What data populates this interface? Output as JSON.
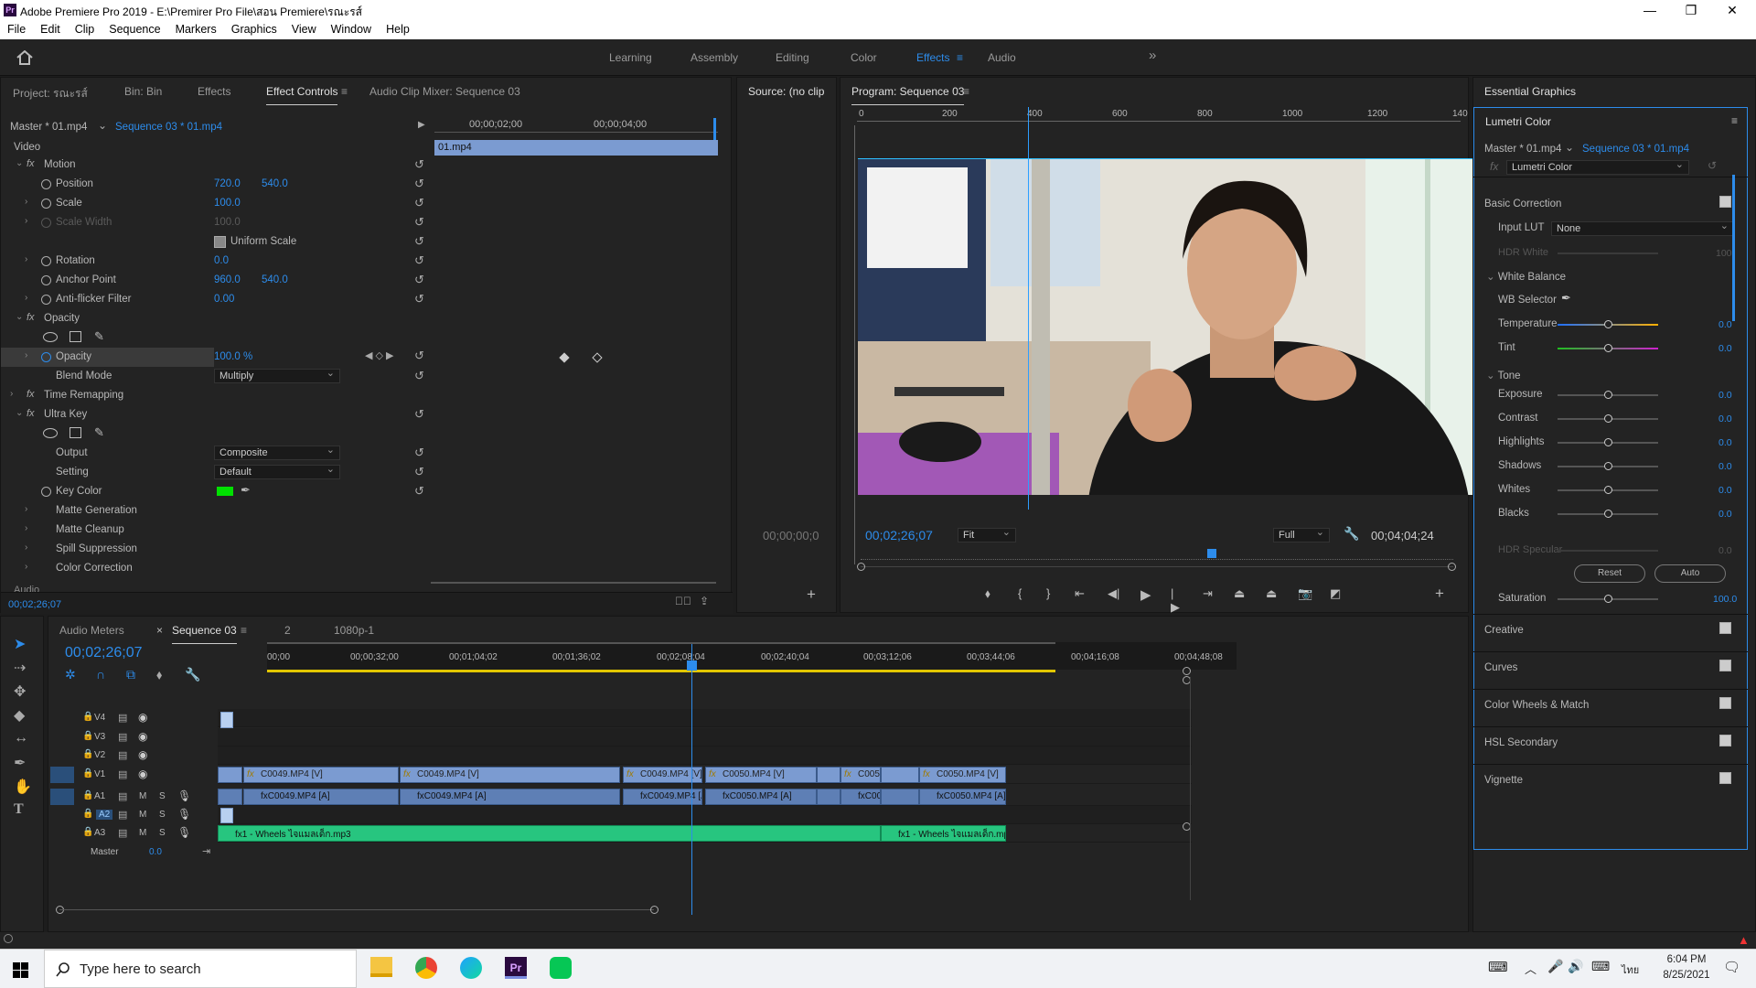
{
  "window": {
    "title": "Adobe Premiere Pro 2019 - E:\\Premirer Pro File\\สอน Premiere\\รณะรส์",
    "minimize": "—",
    "maximize": "❐",
    "close": "✕"
  },
  "menu": [
    "File",
    "Edit",
    "Clip",
    "Sequence",
    "Markers",
    "Graphics",
    "View",
    "Window",
    "Help"
  ],
  "workspaces": [
    "Learning",
    "Assembly",
    "Editing",
    "Color",
    "Effects",
    "Audio"
  ],
  "workspace_active": "Effects",
  "workspace_more": "»",
  "left_tabs": [
    "Project: รณะรส์",
    "Bin: Bin",
    "Effects",
    "Effect Controls",
    "Audio Clip Mixer: Sequence 03"
  ],
  "effect_controls": {
    "master": "Master * 01.mp4",
    "sequence": "Sequence 03 * 01.mp4",
    "ruler": [
      "00;00;02;00",
      "00;00;04;00"
    ],
    "clip": "01.mp4",
    "section_video": "Video",
    "section_audio": "Audio",
    "motion": "Motion",
    "position": "Position",
    "pos_x": "720.0",
    "pos_y": "540.0",
    "scale": "Scale",
    "scale_val": "100.0",
    "scale_width": "Scale Width",
    "scale_width_val": "100.0",
    "uniform_scale": "Uniform Scale",
    "rotation": "Rotation",
    "rotation_val": "0.0",
    "anchor": "Anchor Point",
    "anchor_x": "960.0",
    "anchor_y": "540.0",
    "antiflicker": "Anti-flicker Filter",
    "antiflicker_val": "0.00",
    "opacity_group": "Opacity",
    "opacity": "Opacity",
    "opacity_val": "100.0 %",
    "blend": "Blend Mode",
    "blend_val": "Multiply",
    "time_remap": "Time Remapping",
    "ultra_key": "Ultra Key",
    "output": "Output",
    "output_val": "Composite",
    "setting": "Setting",
    "setting_val": "Default",
    "key_color": "Key Color",
    "key_color_hex": "#00e000",
    "matte_gen": "Matte Generation",
    "matte_cleanup": "Matte Cleanup",
    "spill": "Spill Suppression",
    "color_corr": "Color Correction",
    "timecode": "00;02;26;07"
  },
  "source": {
    "title": "Source: (no clip",
    "timecode": "00;00;00;0"
  },
  "program": {
    "title": "Program: Sequence 03",
    "ruler": [
      "0",
      "200",
      "400",
      "600",
      "800",
      "1000",
      "1200",
      "140"
    ],
    "timecode": "00;02;26;07",
    "fit": "Fit",
    "quality": "Full",
    "duration": "00;04;04;24"
  },
  "essential_graphics": "Essential Graphics",
  "lumetri": {
    "title": "Lumetri Color",
    "master": "Master * 01.mp4",
    "sequence": "Sequence 03 * 01.mp4",
    "effect": "Lumetri Color",
    "basic": "Basic Correction",
    "input_lut": "Input LUT",
    "input_lut_val": "None",
    "hdr_white": "HDR White",
    "hdr_white_val": "100",
    "white_balance": "White Balance",
    "wb_selector": "WB Selector",
    "temperature": "Temperature",
    "tint": "Tint",
    "tone": "Tone",
    "tone_rows": [
      {
        "label": "Exposure",
        "value": "0.0"
      },
      {
        "label": "Contrast",
        "value": "0.0"
      },
      {
        "label": "Highlights",
        "value": "0.0"
      },
      {
        "label": "Shadows",
        "value": "0.0"
      },
      {
        "label": "Whites",
        "value": "0.0"
      },
      {
        "label": "Blacks",
        "value": "0.0"
      }
    ],
    "temp_val": "0.0",
    "tint_val": "0.0",
    "hdr_specular": "HDR Specular",
    "hdr_specular_val": "0.0",
    "reset": "Reset",
    "auto": "Auto",
    "saturation": "Saturation",
    "saturation_val": "100.0",
    "sections": [
      "Creative",
      "Curves",
      "Color Wheels & Match",
      "HSL Secondary",
      "Vignette"
    ]
  },
  "timeline": {
    "tabs": [
      "Audio Meters",
      "Sequence 03",
      "2",
      "1080p-1"
    ],
    "timecode": "00;02;26;07",
    "ruler": [
      "00;00",
      "00;00;32;00",
      "00;01;04;02",
      "00;01;36;02",
      "00;02;08;04",
      "00;02;40;04",
      "00;03;12;06",
      "00;03;44;06",
      "00;04;16;08",
      "00;04;48;08"
    ],
    "video_tracks": [
      "V4",
      "V3",
      "V2",
      "V1"
    ],
    "audio_tracks": [
      "A1",
      "A2",
      "A3"
    ],
    "master": "Master",
    "master_val": "0.0",
    "v1_clips": [
      "C0049.MP4 [V]",
      "C0049.MP4 [V]",
      "C0049.MP4 [V]",
      "C0050.MP4 [V]",
      "C0050.",
      "C0050.MP4 [V]"
    ],
    "a1_clips": [
      "C0049.MP4 [A]",
      "C0049.MP4 [A]",
      "C0049.MP4 [A]",
      "C0050.MP4 [A]",
      "C0050.",
      "C0050.MP4 [A]"
    ],
    "a3_clips": [
      "1 - Wheels ไจแมลเด็ก.mp3",
      "1 - Wheels ไจแมลเด็ก.mp3"
    ],
    "m": "M",
    "s": "S"
  },
  "taskbar": {
    "search": "Type here to search",
    "time": "6:04 PM",
    "date": "8/25/2021",
    "lang": "ไทย"
  }
}
